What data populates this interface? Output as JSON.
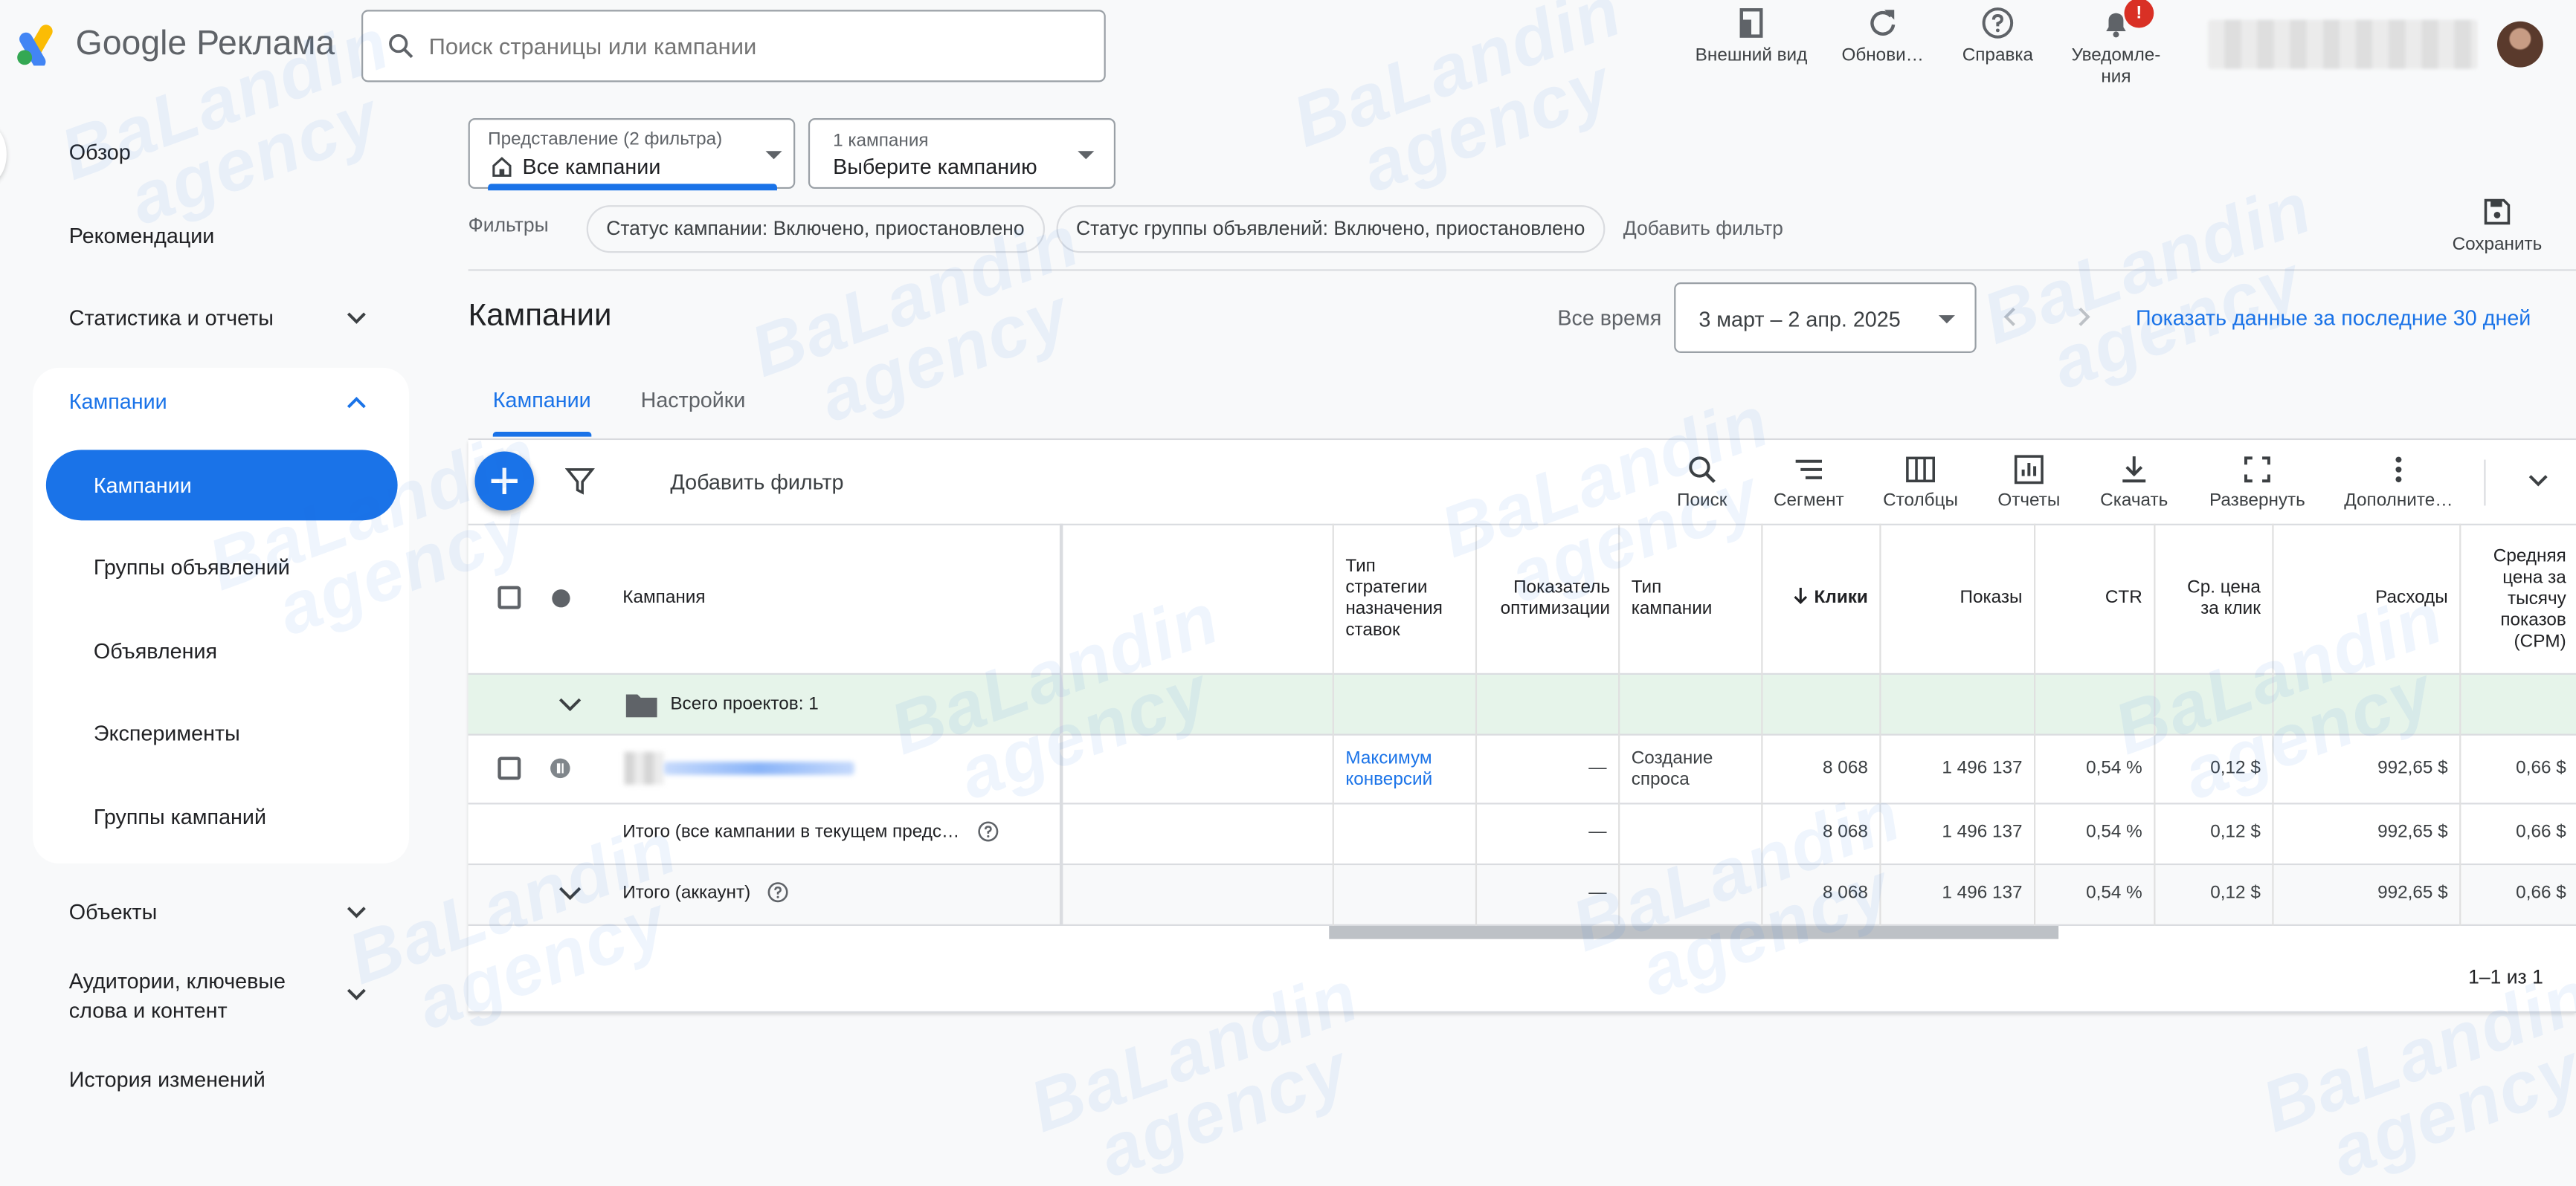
{
  "app": {
    "brand": "Google",
    "product": "Реклама"
  },
  "search": {
    "placeholder": "Поиск страницы или кампании"
  },
  "top_actions": [
    {
      "label": "Внешний вид",
      "icon": "appearance-icon"
    },
    {
      "label": "Обнови…",
      "icon": "refresh-icon"
    },
    {
      "label": "Справка",
      "icon": "help-icon"
    },
    {
      "label": "Уведомле-ния",
      "icon": "bell-icon"
    }
  ],
  "notifications_badge": "!",
  "sidebar": {
    "items": [
      {
        "label": "Обзор"
      },
      {
        "label": "Рекомендации"
      },
      {
        "label": "Статистика и отчеты"
      },
      {
        "label": "Кампании"
      },
      {
        "label": "Объекты"
      },
      {
        "label": "Аудитории, ключевые слова и контент"
      },
      {
        "label": "История изменений"
      }
    ],
    "sub_items": [
      {
        "label": "Кампании"
      },
      {
        "label": "Группы объявлений"
      },
      {
        "label": "Объявления"
      },
      {
        "label": "Эксперименты"
      },
      {
        "label": "Группы кампаний"
      }
    ]
  },
  "view_selector": {
    "small": "Представление (2 фильтра)",
    "value": "Все кампании"
  },
  "campaign_selector": {
    "small": "1 кампания",
    "value": "Выберите кампанию"
  },
  "filters": {
    "label": "Фильтры",
    "chips": [
      "Статус кампании: Включено, приостановлено",
      "Статус группы объявлений: Включено, приостановлено"
    ],
    "add": "Добавить фильтр",
    "save": "Сохранить"
  },
  "page": {
    "title": "Кампании",
    "period_label": "Все время",
    "date_range": "3 март – 2 апр. 2025",
    "last30": "Показать данные за последние 30 дней",
    "tabs": [
      "Кампании",
      "Настройки"
    ]
  },
  "toolbar": {
    "add_filter": "Добавить фильтр",
    "tools": [
      "Поиск",
      "Сегмент",
      "Столбцы",
      "Отчеты",
      "Скачать",
      "Развернуть",
      "Дополните…"
    ]
  },
  "table": {
    "headers": {
      "campaign": "Кампания",
      "strategy": "Тип стратегии назначения ставок",
      "optimization": "Показатель оптимизации",
      "type": "Тип кампании",
      "clicks": "Клики",
      "impressions": "Показы",
      "ctr": "CTR",
      "cpc": "Ср. цена за клик",
      "cost": "Расходы",
      "cpm": "Средняя цена за тысячу показов (CPM)"
    },
    "group_row": "Всего проектов: 1",
    "rows": [
      {
        "strategy": "Максимум конверсий",
        "optimization": "—",
        "type": "Создание спроса",
        "clicks": "8 068",
        "impressions": "1 496 137",
        "ctr": "0,54 %",
        "cpc": "0,12 $",
        "cost": "992,65 $",
        "cpm": "0,66 $"
      }
    ],
    "total_view": {
      "label": "Итого (все кампании в текущем предс…",
      "optimization": "—",
      "clicks": "8 068",
      "impressions": "1 496 137",
      "ctr": "0,54 %",
      "cpc": "0,12 $",
      "cost": "992,65 $",
      "cpm": "0,66 $"
    },
    "total_account": {
      "label": "Итого (аккаунт)",
      "optimization": "—",
      "clicks": "8 068",
      "impressions": "1 496 137",
      "ctr": "0,54 %",
      "cpc": "0,12 $",
      "cost": "992,65 $",
      "cpm": "0,66 $"
    },
    "pagination": "1–1 из 1"
  },
  "watermark": {
    "line1": "BaLandin",
    "line2": "agency"
  },
  "colors": {
    "accent": "#1a73e8",
    "group_row": "#e6f4ea",
    "alert": "#d93025"
  }
}
